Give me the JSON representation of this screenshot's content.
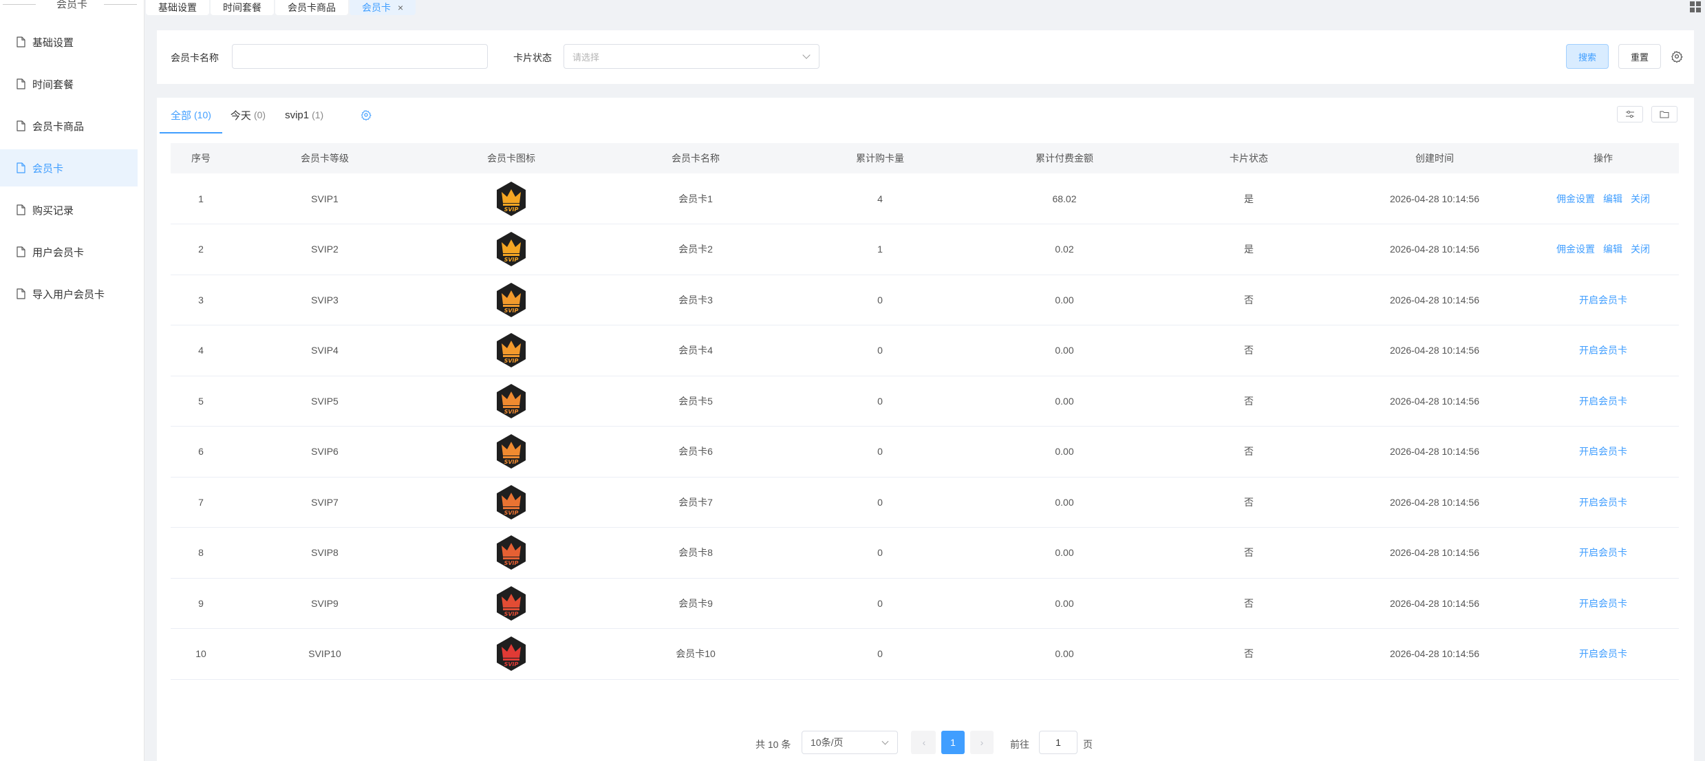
{
  "sidebar": {
    "title": "会员卡",
    "items": [
      {
        "label": "基础设置",
        "active": false
      },
      {
        "label": "时间套餐",
        "active": false
      },
      {
        "label": "会员卡商品",
        "active": false
      },
      {
        "label": "会员卡",
        "active": true
      },
      {
        "label": "购买记录",
        "active": false
      },
      {
        "label": "用户会员卡",
        "active": false
      },
      {
        "label": "导入用户会员卡",
        "active": false
      }
    ]
  },
  "tabs": [
    {
      "label": "基础设置",
      "active": false
    },
    {
      "label": "时间套餐",
      "active": false
    },
    {
      "label": "会员卡商品",
      "active": false
    },
    {
      "label": "会员卡",
      "active": true,
      "closable": true
    }
  ],
  "search": {
    "name_label": "会员卡名称",
    "name_value": "",
    "status_label": "卡片状态",
    "status_placeholder": "请选择",
    "search_button": "搜索",
    "reset_button": "重置"
  },
  "filter_tabs": [
    {
      "label": "全部",
      "count": "(10)",
      "active": true
    },
    {
      "label": "今天",
      "count": "(0)",
      "active": false
    },
    {
      "label": "svip1",
      "count": "(1)",
      "active": false
    }
  ],
  "table": {
    "columns": [
      "序号",
      "会员卡等级",
      "会员卡图标",
      "会员卡名称",
      "累计购卡量",
      "累计付费金额",
      "卡片状态",
      "创建时间",
      "操作"
    ],
    "rows": [
      {
        "index": "1",
        "level": "SVIP1",
        "name": "会员卡1",
        "count": "4",
        "amount": "68.02",
        "status": "是",
        "created": "2026-04-28 10:14:56",
        "actions": [
          "佣金设置",
          "编辑",
          "关闭"
        ]
      },
      {
        "index": "2",
        "level": "SVIP2",
        "name": "会员卡2",
        "count": "1",
        "amount": "0.02",
        "status": "是",
        "created": "2026-04-28 10:14:56",
        "actions": [
          "佣金设置",
          "编辑",
          "关闭"
        ]
      },
      {
        "index": "3",
        "level": "SVIP3",
        "name": "会员卡3",
        "count": "0",
        "amount": "0.00",
        "status": "否",
        "created": "2026-04-28 10:14:56",
        "actions": [
          "开启会员卡"
        ]
      },
      {
        "index": "4",
        "level": "SVIP4",
        "name": "会员卡4",
        "count": "0",
        "amount": "0.00",
        "status": "否",
        "created": "2026-04-28 10:14:56",
        "actions": [
          "开启会员卡"
        ]
      },
      {
        "index": "5",
        "level": "SVIP5",
        "name": "会员卡5",
        "count": "0",
        "amount": "0.00",
        "status": "否",
        "created": "2026-04-28 10:14:56",
        "actions": [
          "开启会员卡"
        ]
      },
      {
        "index": "6",
        "level": "SVIP6",
        "name": "会员卡6",
        "count": "0",
        "amount": "0.00",
        "status": "否",
        "created": "2026-04-28 10:14:56",
        "actions": [
          "开启会员卡"
        ]
      },
      {
        "index": "7",
        "level": "SVIP7",
        "name": "会员卡7",
        "count": "0",
        "amount": "0.00",
        "status": "否",
        "created": "2026-04-28 10:14:56",
        "actions": [
          "开启会员卡"
        ]
      },
      {
        "index": "8",
        "level": "SVIP8",
        "name": "会员卡8",
        "count": "0",
        "amount": "0.00",
        "status": "否",
        "created": "2026-04-28 10:14:56",
        "actions": [
          "开启会员卡"
        ]
      },
      {
        "index": "9",
        "level": "SVIP9",
        "name": "会员卡9",
        "count": "0",
        "amount": "0.00",
        "status": "否",
        "created": "2026-04-28 10:14:56",
        "actions": [
          "开启会员卡"
        ]
      },
      {
        "index": "10",
        "level": "SVIP10",
        "name": "会员卡10",
        "count": "0",
        "amount": "0.00",
        "status": "否",
        "created": "2026-04-28 10:14:56",
        "actions": [
          "开启会员卡"
        ]
      }
    ],
    "crown_colors": [
      "#f5a623",
      "#f5a623",
      "#f39a2c",
      "#f39a2c",
      "#ef8a30",
      "#ef8a30",
      "#ea7332",
      "#e66033",
      "#e24c34",
      "#e03a35"
    ]
  },
  "pagination": {
    "total": "共 10 条",
    "page_size": "10条/页",
    "current_page": "1",
    "goto_label": "前往",
    "goto_value": "1",
    "page_suffix": "页"
  },
  "colors": {
    "accent": "#409eff",
    "crown_bg": "#1f1f1f"
  }
}
